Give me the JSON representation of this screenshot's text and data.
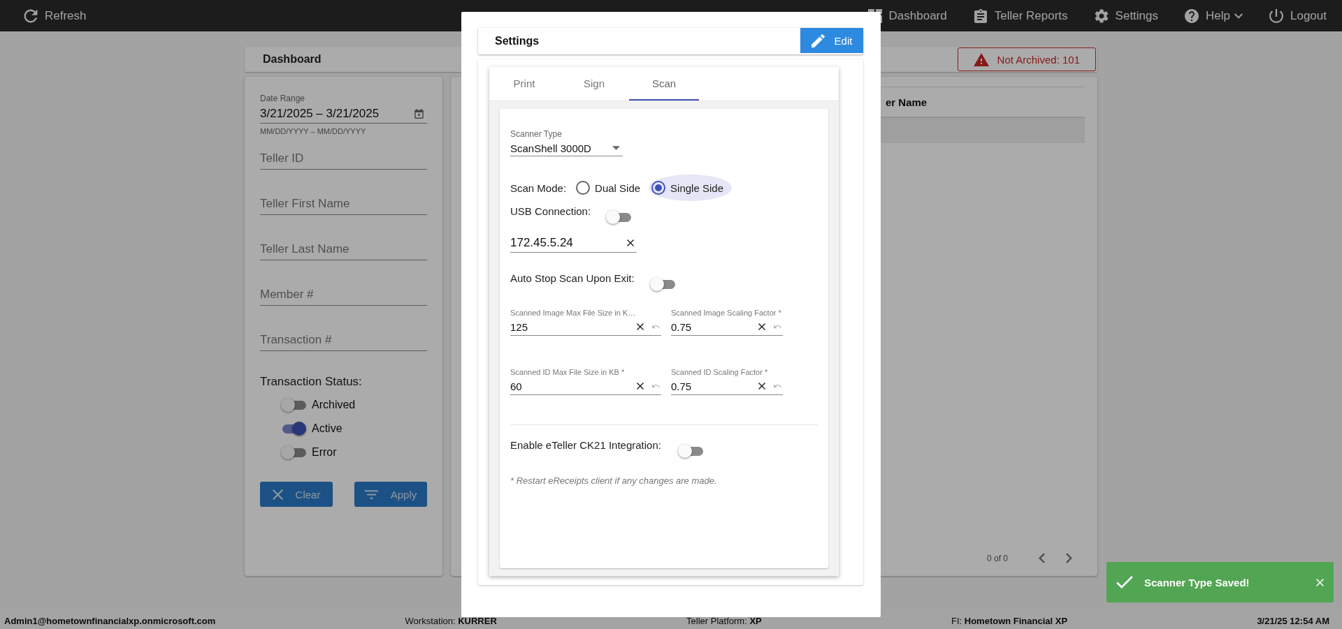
{
  "top_bar": {
    "refresh": "Refresh",
    "nav": [
      {
        "label": "Dashboard",
        "kind": "dashboard"
      },
      {
        "label": "Teller Reports",
        "kind": "reports"
      },
      {
        "label": "Settings",
        "kind": "settings"
      },
      {
        "label": "Help",
        "kind": "help"
      },
      {
        "label": "Logout",
        "kind": "logout"
      }
    ]
  },
  "dashboard": {
    "title": "Dashboard",
    "alert": "Not Archived: 101"
  },
  "filters": {
    "date_range": {
      "label": "Date Range",
      "value": "3/21/2025 – 3/21/2025",
      "hint": "MM/DD/YYYY – MM/DD/YYYY"
    },
    "fields": [
      {
        "placeholder": "Teller ID"
      },
      {
        "placeholder": "Teller First Name"
      },
      {
        "placeholder": "Teller Last Name"
      },
      {
        "placeholder": "Member #"
      },
      {
        "placeholder": "Transaction #"
      }
    ],
    "status_label": "Transaction Status:",
    "statuses": [
      {
        "label": "Archived",
        "on": false
      },
      {
        "label": "Active",
        "on": true
      },
      {
        "label": "Error",
        "on": false
      }
    ],
    "buttons": [
      {
        "label": "Clear",
        "kind": "clear"
      },
      {
        "label": "Apply",
        "kind": "apply"
      }
    ]
  },
  "table": {
    "columns": [
      "er Name"
    ],
    "pager": "0 of 0"
  },
  "settings_modal": {
    "title": "Settings",
    "edit": "Edit",
    "tabs": [
      {
        "label": "Print",
        "selected": false
      },
      {
        "label": "Sign",
        "selected": false
      },
      {
        "label": "Scan",
        "selected": true
      }
    ],
    "scanner_type": {
      "label": "Scanner Type",
      "value": "ScanShell 3000D"
    },
    "scan_mode": {
      "label": "Scan Mode:",
      "options": [
        {
          "label": "Dual Side",
          "selected": false
        },
        {
          "label": "Single Side",
          "selected": true
        }
      ]
    },
    "usb_connection": {
      "label": "USB Connection:",
      "on": false
    },
    "ip_address": {
      "value": "172.45.5.24"
    },
    "auto_stop": {
      "label": "Auto Stop Scan Upon Exit:",
      "on": false
    },
    "size_fields": [
      {
        "label": "Scanned Image Max File Size in K…",
        "value": "125"
      },
      {
        "label": "Scanned Image Scaling Factor *",
        "value": "0.75"
      },
      {
        "label": "Scanned ID Max File Size in KB *",
        "value": "60"
      },
      {
        "label": "Scanned ID Scaling Factor *",
        "value": "0.75"
      }
    ],
    "eteller": {
      "label": "Enable eTeller CK21 Integration:",
      "on": false
    },
    "note": "* Restart eReceipts client if any changes are made."
  },
  "toast": {
    "message": "Scanner Type Saved!"
  },
  "status_bar": {
    "user": "Admin1@hometownfinancialxp.onmicrosoft.com",
    "items": [
      "Workstation: **KURRER**",
      "Teller Platform: **XP**",
      "FI: **Hometown Financial XP**"
    ],
    "time": "3/21/25 12:54 AM"
  }
}
